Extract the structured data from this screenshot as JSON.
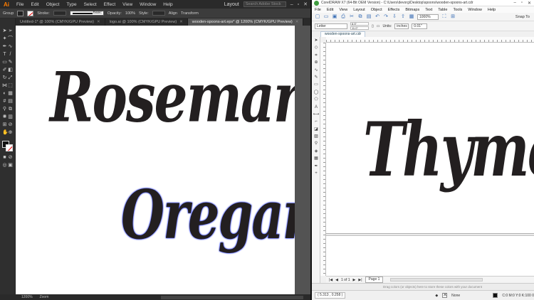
{
  "illustrator": {
    "logo": "Ai",
    "menu": [
      "File",
      "Edit",
      "Object",
      "Type",
      "Select",
      "Effect",
      "View",
      "Window",
      "Help"
    ],
    "layout_label": "Layout",
    "search_placeholder": "Search Adobe Stock",
    "control": {
      "group_label": "Group",
      "stroke_label": "Stroke:",
      "stroke_profile": "Basic",
      "opacity_label": "Opacity:",
      "opacity_value": "100%",
      "style_label": "Style:",
      "align_label": "Align",
      "transform_label": "Transform"
    },
    "tabs": [
      {
        "label": "Untitled-1* @ 100% (CMYK/GPU Preview)",
        "active": false
      },
      {
        "label": "logo.ai @ 100% (CMYK/GPU Preview)",
        "active": false
      },
      {
        "label": "wooden-spoons-art.eps* @ 1200% (CMYK/GPU Preview)",
        "active": true
      }
    ],
    "artboard_text": {
      "word1": "Rosemary",
      "word2": "Oregan"
    },
    "status": {
      "zoom": "1200%",
      "mode": "Zoom"
    }
  },
  "coreldraw": {
    "title": "CorelDRAW X7 (64-Bit OEM Version) - C:\\Users\\devorg\\Desktop\\spoons\\wooden-spoons-art.cdr",
    "menu": [
      "File",
      "Edit",
      "View",
      "Layout",
      "Object",
      "Effects",
      "Bitmaps",
      "Text",
      "Table",
      "Tools",
      "Window",
      "Help"
    ],
    "zoom": "1000%",
    "snap_label": "Snap To",
    "property_bar": {
      "paper": "Letter",
      "width": "8.5\"",
      "height": "11.0\"",
      "units_label": "Units:",
      "units": "inches",
      "nudge": "0.01\""
    },
    "doc_tab": "wooden-spoons-art.cdr",
    "canvas_text": "Thyme",
    "page_nav": {
      "page_count": "1 of 1",
      "page_tab": "Page 1"
    },
    "palette_hint": "Drag colors (or objects) here to store these colors with your document",
    "status": {
      "coords": "( 5.313 , 0.258 )",
      "fill_label": "None",
      "color_info": "C:0 M:0 Y:0 K:100 0"
    }
  }
}
